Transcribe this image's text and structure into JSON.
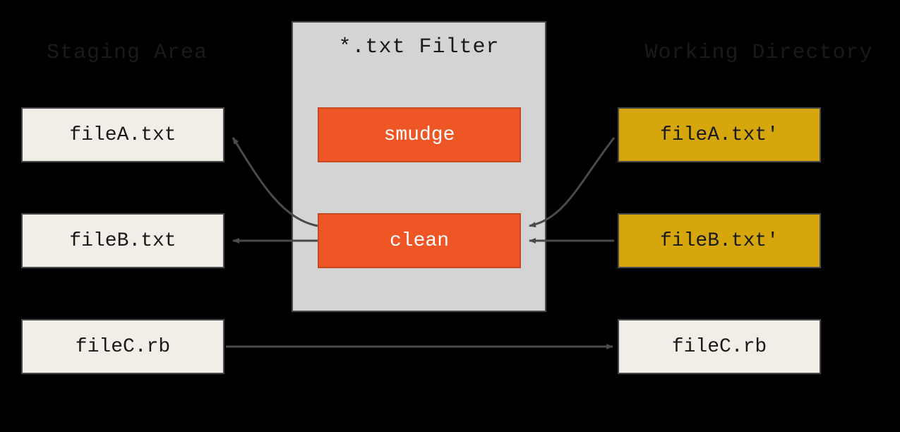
{
  "headings": {
    "staging": "Staging Area",
    "filter": "*.txt Filter",
    "working": "Working Directory"
  },
  "staging_files": {
    "a": "fileA.txt",
    "b": "fileB.txt",
    "c": "fileC.rb"
  },
  "working_files": {
    "a": "fileA.txt'",
    "b": "fileB.txt'",
    "c": "fileC.rb"
  },
  "filter_ops": {
    "smudge": "smudge",
    "clean": "clean"
  },
  "colors": {
    "bg_light": "#f0eee6",
    "bg_gold": "#d6a60d",
    "bg_orange": "#ee5626",
    "panel_gray": "#d4d4d4",
    "stroke": "#4a4a4a"
  }
}
